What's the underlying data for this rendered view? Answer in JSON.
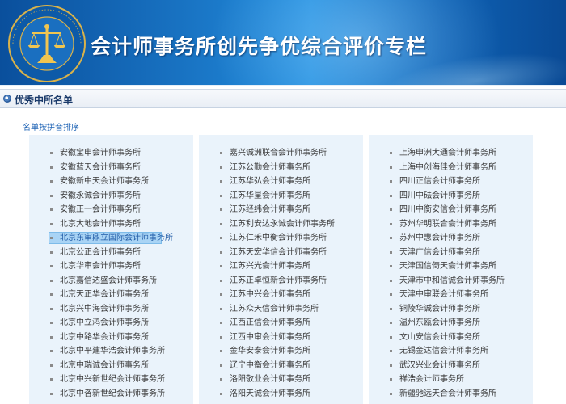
{
  "header": {
    "title": "会计师事务所创先争优综合评价专栏",
    "logo_icon": "cicpa-emblem-icon",
    "colors": {
      "banner_dark": "#0a4f9c",
      "banner_light": "#1f8ee0"
    }
  },
  "section": {
    "title": "优秀中所名单",
    "subtitle": "名单按拼音排序"
  },
  "columns": [
    {
      "items": [
        "安徽宝申会计师事务所",
        "安徽蓝天会计师事务所",
        "安徽新中天会计师事务所",
        "安徽永诚会计师事务所",
        "安徽正一会计师事务所",
        "北京大地会计师事务所",
        "北京东审鼎立国际会计师事务所",
        "北京公正会计师事务所",
        "北京华审会计师事务所",
        "北京嘉信达盛会计师事务所",
        "北京天正华会计师事务所",
        "北京兴中海会计师事务所",
        "北京中立鸿会计师事务所",
        "北京中路华会计师事务所",
        "北京中平建华浩会计师事务所",
        "北京中瑞诚会计师事务所",
        "北京中兴新世纪会计师事务所",
        "北京中咨新世纪会计师事务所"
      ],
      "highlight_index": 6
    },
    {
      "items": [
        "嘉兴诚洲联合会计师事务所",
        "江苏公勤会计师事务所",
        "江苏华弘会计师事务所",
        "江苏华星会计师事务所",
        "江苏经纬会计师事务所",
        "江苏利安达永诚会计师事务所",
        "江苏仁禾中衡会计师事务所",
        "江苏天宏华信会计师事务所",
        "江苏兴光会计师事务所",
        "江苏正卓恒新会计师事务所",
        "江苏中兴会计师事务所",
        "江苏众天信会计师事务所",
        "江西正信会计师事务所",
        "江西中审会计师事务所",
        "金华安泰会计师事务所",
        "辽宁中衡会计师事务所",
        "洛阳敬业会计师事务所",
        "洛阳天诚会计师事务所"
      ]
    },
    {
      "items": [
        "上海申洲大通会计师事务所",
        "上海中创海佳会计师事务所",
        "四川正信会计师事务所",
        "四川中砝会计师事务所",
        "四川中衡安信会计师事务所",
        "苏州华明联合会计师事务所",
        "苏州中惠会计师事务所",
        "天津广信会计师事务所",
        "天津国信倚天会计师事务所",
        "天津市中和信诚会计师事务所",
        "天津中审联会计师事务所",
        "铜陵华诚会计师事务所",
        "温州东瓯会计师事务所",
        "文山安信会计师事务所",
        "无锡金达信会计师事务所",
        "武汉兴业会计师事务所",
        "祥浩会计师事务所",
        "新疆驰远天合会计师事务所"
      ]
    }
  ]
}
